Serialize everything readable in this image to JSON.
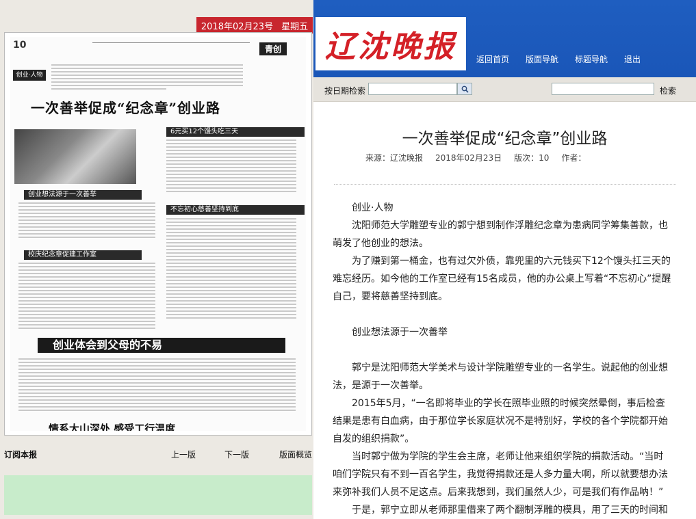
{
  "header": {
    "date": "2018年02月23号",
    "weekday": "星期五",
    "logo_text": "辽沈晚报",
    "nav": [
      "返回首页",
      "版面导航",
      "标题导航",
      "退出"
    ]
  },
  "thumbnail": {
    "page_no": "10",
    "section_tag": "青创",
    "sub_tag": "创业·人物",
    "headline_main": "一次善举促成“纪念章”创业路",
    "box_a": "6元买12个馒头吃三天",
    "box_b": "创业想法源于一次善举",
    "box_c": "不忘初心慈善坚持到底",
    "box_d": "校庆纪念章促建工作室",
    "headline_second": "创业体会到父母的不易",
    "headline_bottom": "情系大山深处 感受工行温度"
  },
  "left_links": {
    "subscribe": "订阅本报",
    "prev": "上一版",
    "next": "下一版",
    "overview": "版面概览"
  },
  "search": {
    "date_label": "按日期检索",
    "search_button": "检索"
  },
  "article": {
    "title": "一次善举促成“纪念章”创业路",
    "source": "来源：辽沈晚报",
    "date": "2018年02月23日",
    "page": "版次：10",
    "author": "作者："
  },
  "paragraphs": [
    "创业·人物",
    "沈阳师范大学雕塑专业的郭宁想到制作浮雕纪念章为患病同学筹集善款，也萌发了他创业的想法。",
    "为了赚到第一桶金，也有过欠外债，靠兜里的六元钱买下12个馒头扛三天的难忘经历。如今他的工作室已经有15名成员，他的办公桌上写着“不忘初心”提醒自己，要将慈善坚持到底。",
    "创业想法源于一次善举",
    "郭宁是沈阳师范大学美术与设计学院雕塑专业的一名学生。说起他的创业想法，是源于一次善举。",
    "2015年5月，“一名即将毕业的学长在照毕业照的时候突然晕倒，事后检查结果是患有白血病，由于那位学长家庭状况不是特别好，学校的各个学院都开始自发的组织捐款”。",
    "当时郭宁做为学院的学生会主席，老师让他来组织学院的捐款活动。“当时咱们学院只有不到一百名学生，我觉得捐款还是人多力量大啊，所以就要想办法来弥补我们人员不足这点。后来我想到，我们虽然人少，可是我们有作品呐！”",
    "于是，郭宁立即从老师那里借来了两个翻制浮雕的模具，用了三天的时间和"
  ]
}
